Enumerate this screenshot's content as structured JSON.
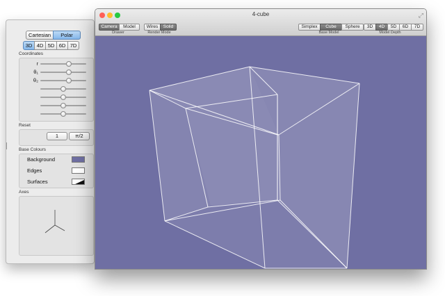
{
  "window": {
    "title": "4-cube",
    "resize_glyph": "⤢",
    "traffic": {
      "close": "#ff5f57",
      "minimize": "#ffbd2e",
      "zoom": "#28c940"
    },
    "toolbar": {
      "drawer": {
        "items": [
          "Camera",
          "Model"
        ],
        "selected": "Camera",
        "caption": "Drawer"
      },
      "render": {
        "items": [
          "Wires",
          "Solid"
        ],
        "selected": "Solid",
        "caption": "Render Mode"
      },
      "base": {
        "items": [
          "Simplex",
          "Cube",
          "Sphere"
        ],
        "selected": "Cube",
        "caption": "Base Model"
      },
      "depth": {
        "items": [
          "3D",
          "4D",
          "5D",
          "6D",
          "7D"
        ],
        "selected": "4D",
        "caption": "Model Depth"
      }
    }
  },
  "viewport": {
    "background": "#6f6fa3",
    "edge_color": "#ffffff",
    "surface_color": "#ffffff"
  },
  "panel": {
    "coord_mode": {
      "items": [
        "Cartesian",
        "Polar"
      ],
      "selected": "Polar"
    },
    "dims": {
      "items": [
        "3D",
        "4D",
        "5D",
        "6D",
        "7D"
      ],
      "selected": "3D"
    },
    "coordinates": {
      "label": "Coordinates",
      "sliders": [
        {
          "label": "r",
          "value": 0.62
        },
        {
          "label": "θ₁",
          "value": 0.62
        },
        {
          "label": "θ₂",
          "value": 0.62
        },
        {
          "label": "",
          "value": 0.5
        },
        {
          "label": "",
          "value": 0.5
        },
        {
          "label": "",
          "value": 0.5
        },
        {
          "label": "",
          "value": 0.5
        }
      ]
    },
    "reset": {
      "label": "Reset",
      "buttons": [
        "1",
        "π/2"
      ]
    },
    "base_colours": {
      "label": "Base Colours",
      "rows": [
        {
          "label": "Background",
          "color": "#6f6fa3"
        },
        {
          "label": "Edges",
          "color": "#ffffff"
        },
        {
          "label": "Surfaces",
          "color": "#111111"
        }
      ]
    },
    "axes": {
      "label": "Axes"
    }
  }
}
